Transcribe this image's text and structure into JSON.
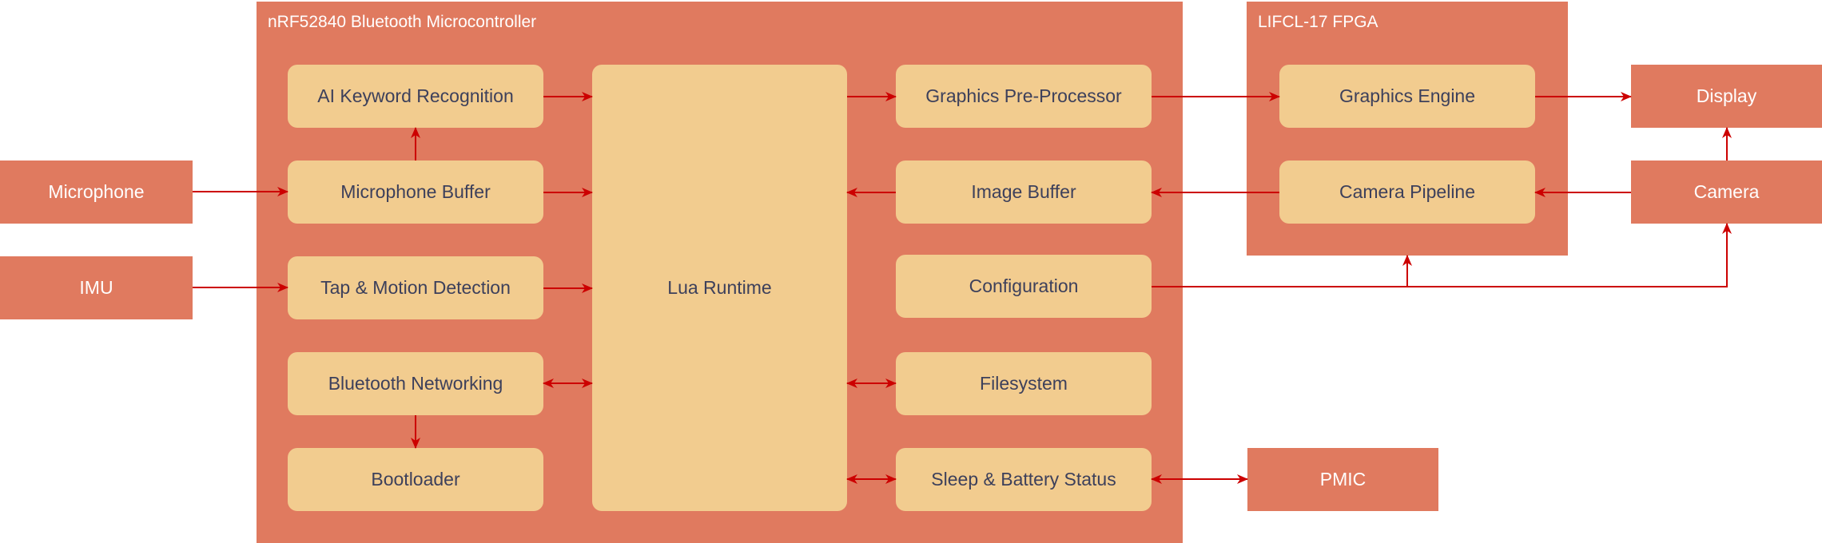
{
  "diagram": {
    "colors": {
      "block": "#e07a5f",
      "module": "#f2cc8f",
      "module_text": "#3d405b",
      "block_text": "#ffffff",
      "wire": "#cc0000"
    },
    "containers": {
      "mcu": {
        "title": "nRF52840 Bluetooth Microcontroller"
      },
      "fpga": {
        "title": "LIFCL-17 FPGA"
      }
    },
    "external": {
      "microphone": "Microphone",
      "imu": "IMU",
      "display": "Display",
      "camera": "Camera",
      "pmic": "PMIC"
    },
    "mcu_modules": {
      "ai_keyword": "AI Keyword Recognition",
      "mic_buffer": "Microphone Buffer",
      "tap_motion": "Tap & Motion Detection",
      "bt_networking": "Bluetooth Networking",
      "bootloader": "Bootloader",
      "lua_runtime": "Lua Runtime",
      "gfx_preproc": "Graphics Pre-Processor",
      "image_buffer": "Image Buffer",
      "configuration": "Configuration",
      "filesystem": "Filesystem",
      "sleep_battery": "Sleep & Battery Status"
    },
    "fpga_modules": {
      "gfx_engine": "Graphics Engine",
      "camera_pipeline": "Camera Pipeline"
    },
    "connections": [
      {
        "from": "Microphone",
        "to": "Microphone Buffer",
        "type": "directed"
      },
      {
        "from": "IMU",
        "to": "Tap & Motion Detection",
        "type": "directed"
      },
      {
        "from": "Microphone Buffer",
        "to": "AI Keyword Recognition",
        "type": "directed"
      },
      {
        "from": "AI Keyword Recognition",
        "to": "Lua Runtime",
        "type": "directed"
      },
      {
        "from": "Microphone Buffer",
        "to": "Lua Runtime",
        "type": "directed"
      },
      {
        "from": "Tap & Motion Detection",
        "to": "Lua Runtime",
        "type": "directed"
      },
      {
        "from": "Bluetooth Networking",
        "to": "Lua Runtime",
        "type": "bidirectional"
      },
      {
        "from": "Bluetooth Networking",
        "to": "Bootloader",
        "type": "directed"
      },
      {
        "from": "Lua Runtime",
        "to": "Graphics Pre-Processor",
        "type": "directed"
      },
      {
        "from": "Image Buffer",
        "to": "Lua Runtime",
        "type": "directed"
      },
      {
        "from": "Lua Runtime",
        "to": "Filesystem",
        "type": "bidirectional"
      },
      {
        "from": "Lua Runtime",
        "to": "Sleep & Battery Status",
        "type": "bidirectional"
      },
      {
        "from": "Graphics Pre-Processor",
        "to": "Graphics Engine",
        "type": "directed"
      },
      {
        "from": "Camera Pipeline",
        "to": "Image Buffer",
        "type": "directed"
      },
      {
        "from": "Graphics Engine",
        "to": "Display",
        "type": "directed"
      },
      {
        "from": "Camera",
        "to": "Camera Pipeline",
        "type": "directed"
      },
      {
        "from": "Camera",
        "to": "Display",
        "type": "directed"
      },
      {
        "from": "Configuration",
        "to": "LIFCL-17 FPGA",
        "type": "directed"
      },
      {
        "from": "Configuration",
        "to": "Camera",
        "type": "directed"
      },
      {
        "from": "Sleep & Battery Status",
        "to": "PMIC",
        "type": "bidirectional"
      }
    ]
  }
}
